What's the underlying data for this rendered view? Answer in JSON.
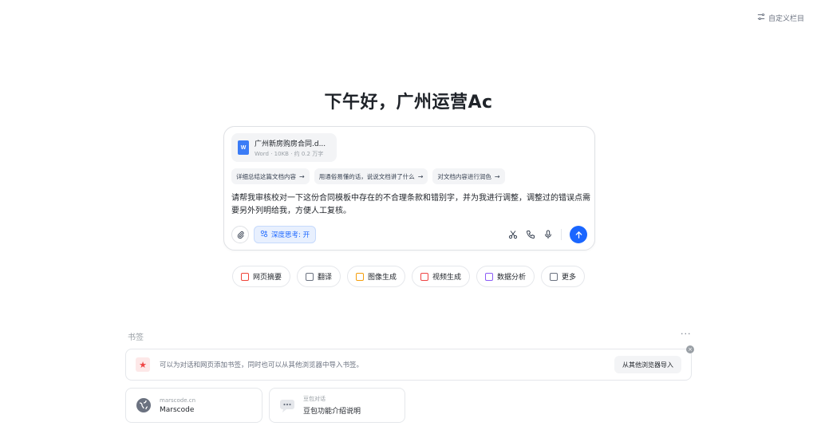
{
  "header": {
    "customize_label": "自定义栏目"
  },
  "greeting": "下午好，广州运营Ac",
  "composer": {
    "file": {
      "name": "广州新房购房合同.d...",
      "meta": "Word · 10KB · 约 0.2 万字",
      "icon_label": "W"
    },
    "suggestions": [
      {
        "label": "详细总结这篇文档内容"
      },
      {
        "label": "用通俗易懂的话，说说文档讲了什么"
      },
      {
        "label": "对文档内容进行润色"
      }
    ],
    "prompt": "请帮我审核校对一下这份合同模板中存在的不合理条款和错别字，并为我进行调整，调整过的错误点需要另外列明给我，方便人工复核。",
    "deep_think_label": "深度思考: 开"
  },
  "quick_actions": [
    {
      "label": "网页摘要",
      "color": "#f04438"
    },
    {
      "label": "翻译",
      "color": "#6b7280"
    },
    {
      "label": "图像生成",
      "color": "#f59e0b"
    },
    {
      "label": "视频生成",
      "color": "#ef4444"
    },
    {
      "label": "数据分析",
      "color": "#8b5cf6"
    },
    {
      "label": "更多",
      "color": "#6b7280"
    }
  ],
  "bookmarks": {
    "title": "书签",
    "more": "···",
    "banner_text": "可以为对话和网页添加书签，同时也可以从其他浏览器中导入书签。",
    "import_label": "从其他浏览器导入",
    "items": [
      {
        "sub": "marscode.cn",
        "name": "Marscode"
      },
      {
        "sub": "豆包对话",
        "name": "豆包功能介绍说明"
      }
    ]
  },
  "colors": {
    "accent": "#1a66ff"
  }
}
